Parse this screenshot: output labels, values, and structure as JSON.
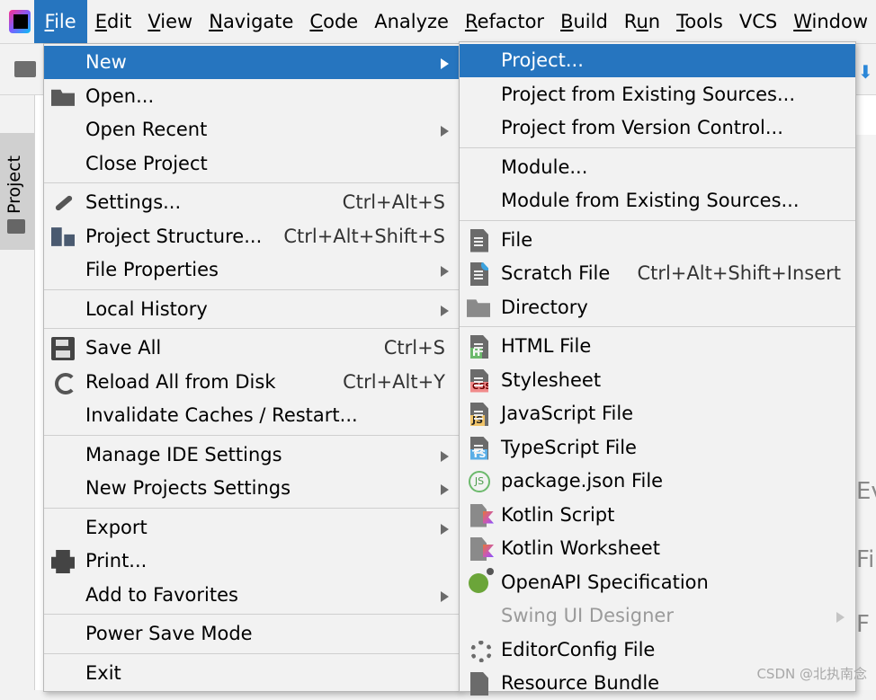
{
  "menubar": {
    "items": [
      {
        "label": "File",
        "mnemonic_index": 0
      },
      {
        "label": "Edit",
        "mnemonic_index": 0
      },
      {
        "label": "View",
        "mnemonic_index": 0
      },
      {
        "label": "Navigate",
        "mnemonic_index": 0
      },
      {
        "label": "Code",
        "mnemonic_index": 0
      },
      {
        "label": "Analyze",
        "mnemonic_index": -1
      },
      {
        "label": "Refactor",
        "mnemonic_index": 0
      },
      {
        "label": "Build",
        "mnemonic_index": 0
      },
      {
        "label": "Run",
        "mnemonic_index": 1
      },
      {
        "label": "Tools",
        "mnemonic_index": 0
      },
      {
        "label": "VCS",
        "mnemonic_index": -1
      },
      {
        "label": "Window",
        "mnemonic_index": 0
      }
    ],
    "active": "File"
  },
  "sidebar": {
    "project_tab": "Project"
  },
  "file_menu": {
    "items": [
      {
        "label": "New",
        "icon": "none",
        "submenu": true,
        "selected": true
      },
      {
        "label": "Open...",
        "icon": "folder-open-icon"
      },
      {
        "label": "Open Recent",
        "icon": "none",
        "submenu": true
      },
      {
        "label": "Close Project",
        "icon": "none"
      },
      {
        "sep": true
      },
      {
        "label": "Settings...",
        "icon": "wrench-icon",
        "shortcut": "Ctrl+Alt+S"
      },
      {
        "label": "Project Structure...",
        "icon": "project-structure-icon",
        "shortcut": "Ctrl+Alt+Shift+S"
      },
      {
        "label": "File Properties",
        "icon": "none",
        "submenu": true
      },
      {
        "sep": true
      },
      {
        "label": "Local History",
        "icon": "none",
        "submenu": true
      },
      {
        "sep": true
      },
      {
        "label": "Save All",
        "icon": "save-icon",
        "shortcut": "Ctrl+S"
      },
      {
        "label": "Reload All from Disk",
        "icon": "reload-icon",
        "shortcut": "Ctrl+Alt+Y"
      },
      {
        "label": "Invalidate Caches / Restart...",
        "icon": "none"
      },
      {
        "sep": true
      },
      {
        "label": "Manage IDE Settings",
        "icon": "none",
        "submenu": true
      },
      {
        "label": "New Projects Settings",
        "icon": "none",
        "submenu": true
      },
      {
        "sep": true
      },
      {
        "label": "Export",
        "icon": "none",
        "submenu": true
      },
      {
        "label": "Print...",
        "icon": "printer-icon"
      },
      {
        "label": "Add to Favorites",
        "icon": "none",
        "submenu": true
      },
      {
        "sep": true
      },
      {
        "label": "Power Save Mode",
        "icon": "none"
      },
      {
        "sep": true
      },
      {
        "label": "Exit",
        "icon": "none"
      }
    ]
  },
  "new_menu": {
    "items": [
      {
        "label": "Project...",
        "icon": "none",
        "selected": true
      },
      {
        "label": "Project from Existing Sources...",
        "icon": "none"
      },
      {
        "label": "Project from Version Control...",
        "icon": "none"
      },
      {
        "sep": true
      },
      {
        "label": "Module...",
        "icon": "none"
      },
      {
        "label": "Module from Existing Sources...",
        "icon": "none"
      },
      {
        "sep": true
      },
      {
        "label": "File",
        "icon": "file-icon"
      },
      {
        "label": "Scratch File",
        "icon": "scratch-file-icon",
        "shortcut": "Ctrl+Alt+Shift+Insert"
      },
      {
        "label": "Directory",
        "icon": "directory-icon"
      },
      {
        "sep": true
      },
      {
        "label": "HTML File",
        "icon": "html-file-icon",
        "tag": "H"
      },
      {
        "label": "Stylesheet",
        "icon": "css-file-icon",
        "tag": "CSS"
      },
      {
        "label": "JavaScript File",
        "icon": "js-file-icon",
        "tag": "JS"
      },
      {
        "label": "TypeScript File",
        "icon": "ts-file-icon",
        "tag": "TS"
      },
      {
        "label": "package.json File",
        "icon": "nodejs-icon",
        "tag": "JS"
      },
      {
        "label": "Kotlin Script",
        "icon": "kotlin-script-icon"
      },
      {
        "label": "Kotlin Worksheet",
        "icon": "kotlin-worksheet-icon"
      },
      {
        "label": "OpenAPI Specification",
        "icon": "openapi-icon"
      },
      {
        "label": "Swing UI Designer",
        "icon": "none",
        "submenu": true,
        "disabled": true
      },
      {
        "label": "EditorConfig File",
        "icon": "gear-icon"
      },
      {
        "label": "Resource Bundle",
        "icon": "resource-bundle-icon"
      }
    ]
  },
  "watermark": "CSDN @北执南念"
}
